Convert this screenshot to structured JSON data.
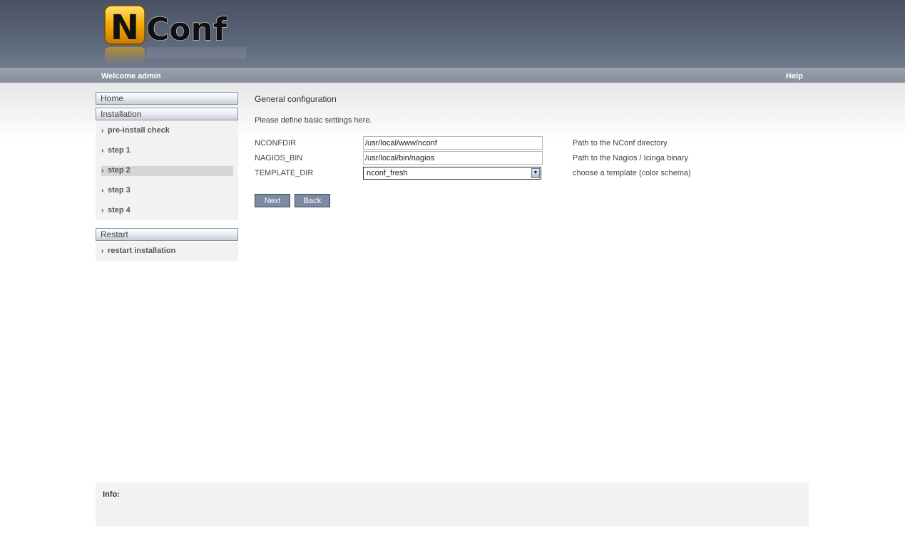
{
  "header": {
    "logo_text": "NConf",
    "welcome": "Welcome admin",
    "help": "Help"
  },
  "sidebar": {
    "home": "Home",
    "installation": {
      "title": "Installation",
      "items": [
        {
          "label": "pre-install check",
          "active": false
        },
        {
          "label": "step 1",
          "active": false
        },
        {
          "label": "step 2",
          "active": true
        },
        {
          "label": "step 3",
          "active": false
        },
        {
          "label": "step 4",
          "active": false
        }
      ]
    },
    "restart": {
      "title": "Restart",
      "items": [
        {
          "label": "restart installation"
        }
      ]
    }
  },
  "main": {
    "title": "General configuration",
    "intro": "Please define basic settings here.",
    "fields": [
      {
        "label": "NCONFDIR",
        "value": "/usr/local/www/nconf",
        "description": "Path to the NConf directory"
      },
      {
        "label": "NAGIOS_BIN",
        "value": "/usr/local/bin/nagios",
        "description": "Path to the Nagios / Icinga binary"
      },
      {
        "label": "TEMPLATE_DIR",
        "value": "nconf_fresh",
        "description": "choose a template (color schema)"
      }
    ],
    "buttons": {
      "next": "Next",
      "back": "Back"
    }
  },
  "info": {
    "label": "Info:"
  },
  "colors": {
    "header": "#4a5262",
    "userbar": "#8f96a4",
    "button": "#7c8aa4",
    "logo_accent": "#f5a800"
  }
}
